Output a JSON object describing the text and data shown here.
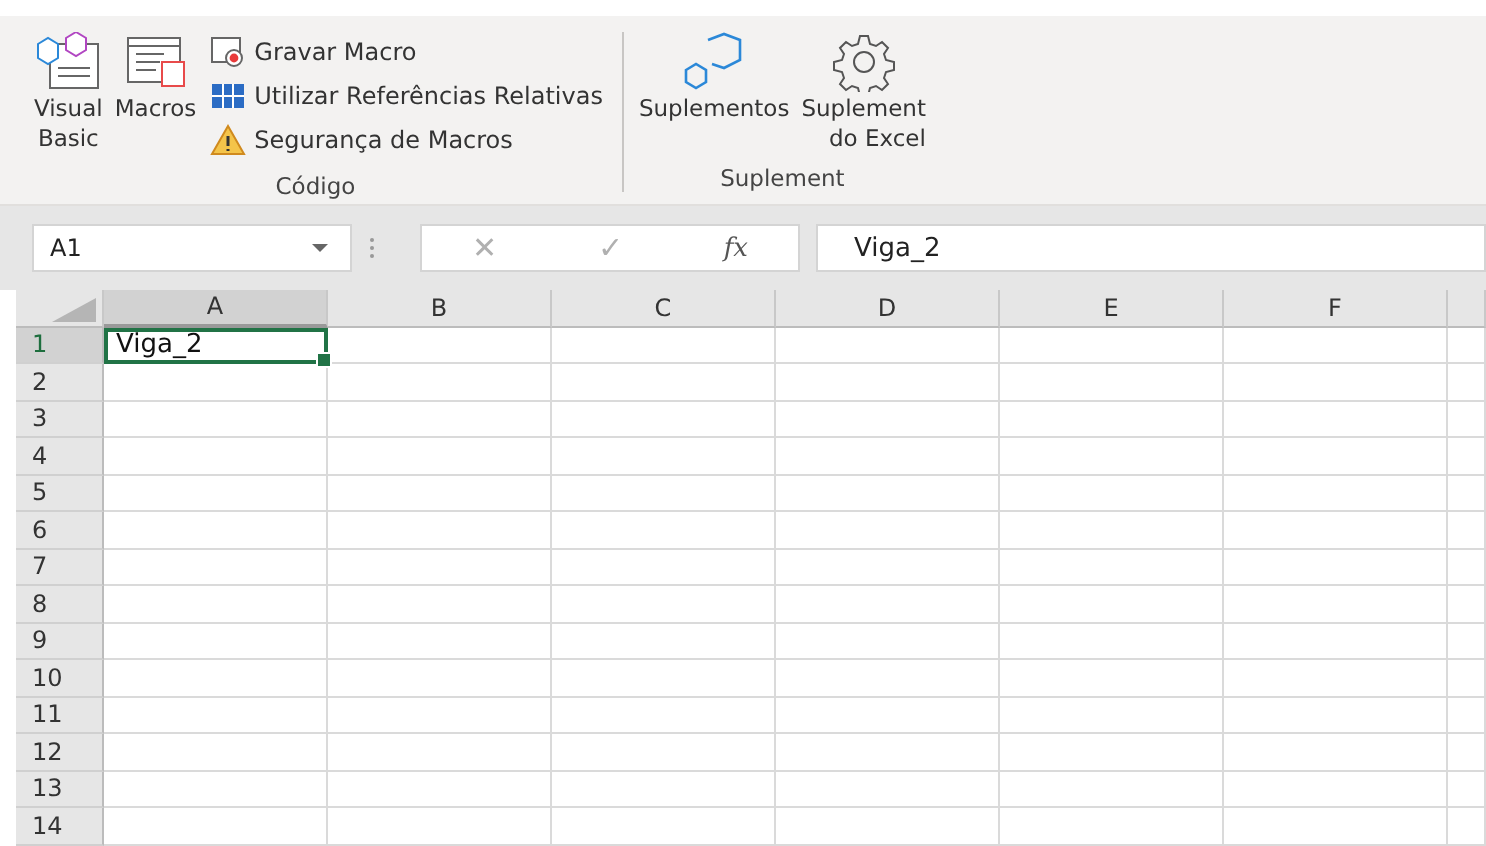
{
  "ribbon": {
    "groups": [
      {
        "label": "Código",
        "large_buttons": [
          {
            "kind": "vba",
            "label": "Visual\nBasic"
          },
          {
            "kind": "macros",
            "label": "Macros"
          }
        ],
        "small_buttons": [
          {
            "kind": "record",
            "label": "Gravar Macro"
          },
          {
            "kind": "relative",
            "label": "Utilizar Referências Relativas"
          },
          {
            "kind": "security",
            "label": "Segurança de Macros"
          }
        ]
      },
      {
        "label": "Suplement",
        "large_buttons": [
          {
            "kind": "addins",
            "label": "Suplementos"
          },
          {
            "kind": "gear",
            "label": "Suplement\ndo Excel"
          }
        ]
      }
    ]
  },
  "formula_bar": {
    "name_box": "A1",
    "cancel": "✕",
    "enter": "✓",
    "fx": "fx",
    "value": "Viga_2"
  },
  "sheet": {
    "columns": [
      {
        "label": "A",
        "selected": true
      },
      {
        "label": "B",
        "selected": false
      },
      {
        "label": "C",
        "selected": false
      },
      {
        "label": "D",
        "selected": false
      },
      {
        "label": "E",
        "selected": false
      },
      {
        "label": "F",
        "selected": false
      }
    ],
    "rows": [
      {
        "label": "1",
        "selected": true,
        "cells": [
          "Viga_2"
        ]
      },
      {
        "label": "2",
        "selected": false
      },
      {
        "label": "3",
        "selected": false
      },
      {
        "label": "4",
        "selected": false
      },
      {
        "label": "5",
        "selected": false
      },
      {
        "label": "6",
        "selected": false
      },
      {
        "label": "7",
        "selected": false
      },
      {
        "label": "8",
        "selected": false
      },
      {
        "label": "9",
        "selected": false
      },
      {
        "label": "10",
        "selected": false
      },
      {
        "label": "11",
        "selected": false
      },
      {
        "label": "12",
        "selected": false
      },
      {
        "label": "13",
        "selected": false
      },
      {
        "label": "14",
        "selected": false
      }
    ]
  }
}
